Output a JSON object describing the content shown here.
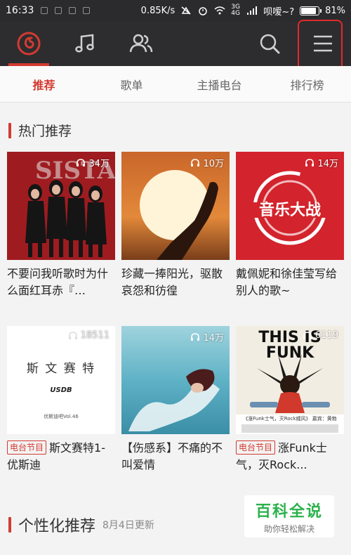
{
  "status_bar": {
    "time": "16:33",
    "network_speed": "0.85K/s",
    "signal_badge": "3G 4G",
    "carrier": "呗嗳~?",
    "battery_percent": "81%",
    "battery_level": 0.81
  },
  "nav": {
    "icons": [
      "netease-music-logo-icon",
      "music-note-icon",
      "friends-icon",
      "search-icon",
      "menu-icon"
    ]
  },
  "tabs": {
    "items": [
      "推荐",
      "歌单",
      "主播电台",
      "排行榜"
    ],
    "active": "推荐"
  },
  "hot": {
    "title": "热门推荐",
    "cards": [
      {
        "count": "34万",
        "title": "不要问我听歌时为什么面红耳赤『…",
        "badge": ""
      },
      {
        "count": "10万",
        "title": "珍藏一捧阳光，驱散哀怨和彷徨",
        "badge": ""
      },
      {
        "count": "14万",
        "title": "戴佩妮和徐佳莹写给别人的歌~",
        "badge": ""
      },
      {
        "count": "18511",
        "title": "斯文赛特1-优斯迪",
        "badge": "电台节目",
        "cover_text": "斯 文 赛 特",
        "cover_logo": "USDB",
        "cover_small": "优斯迪吧Vol.46"
      },
      {
        "count": "14万",
        "title": "【伤感系】不痛的不叫爱情",
        "badge": ""
      },
      {
        "count": "6119",
        "title": "涨Funk士气，灭Rock...",
        "badge": "电台节目",
        "cover_text": "THIS IS FUNK",
        "cover_small": "《涨Funk士气，灭Rock威风》 嘉宾：黄勃"
      }
    ]
  },
  "personal": {
    "title": "个性化推荐",
    "updated": "8月4日更新"
  },
  "watermark": {
    "main": "百科全说",
    "sub": "助你轻松解决"
  },
  "colors": {
    "accent": "#d33a31",
    "header": "#2d2d2f",
    "watermark_green": "#2bb24c"
  }
}
